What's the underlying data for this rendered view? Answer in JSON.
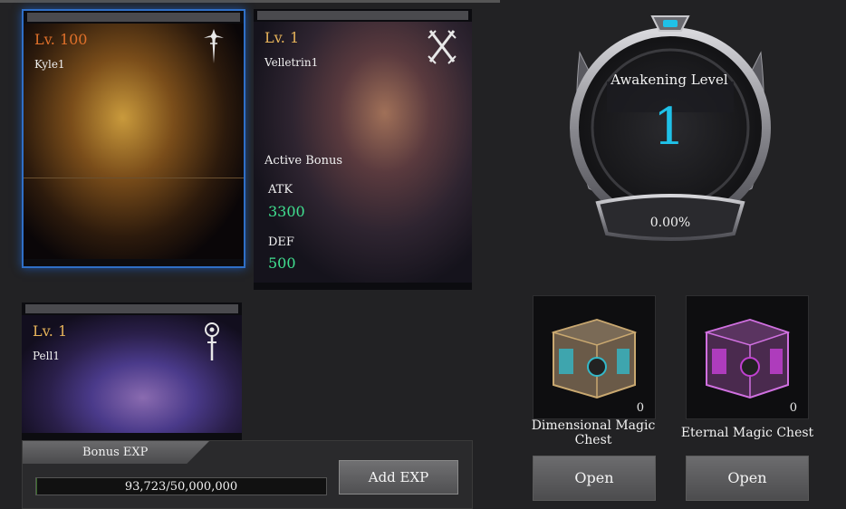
{
  "characters": [
    {
      "level": "Lv. 100",
      "name": "Kyle1",
      "class_icon": "sword-class-icon"
    },
    {
      "level": "Lv. 1",
      "name": "Velletrin1",
      "class_icon": "crossed-blades-icon"
    },
    {
      "level": "Lv. 1",
      "name": "Pell1",
      "class_icon": "staff-class-icon"
    }
  ],
  "active_bonus": {
    "title": "Active Bonus",
    "atk_label": "ATK",
    "atk_value": "3300",
    "def_label": "DEF",
    "def_value": "500"
  },
  "exp": {
    "tab_label": "Bonus EXP",
    "progress_text": "93,723/50,000,000",
    "progress_fraction": 0.0019,
    "add_button": "Add EXP"
  },
  "awakening": {
    "label": "Awakening Level",
    "level": "1",
    "percent": "0.00%"
  },
  "chests": [
    {
      "name": "Dimensional Magic Chest",
      "name_lines": [
        "Dimensional Magic",
        "Chest"
      ],
      "count": "0",
      "button": "Open",
      "accent": "#33b8c8"
    },
    {
      "name": "Eternal Magic Chest",
      "name_lines": [
        "Eternal Magic Chest"
      ],
      "count": "0",
      "button": "Open",
      "accent": "#c040d0"
    }
  ],
  "colors": {
    "accent_blue": "#1fc1e8",
    "stat_green": "#40e090",
    "level_orange": "#e0702a",
    "level_gold": "#e6b35a"
  }
}
